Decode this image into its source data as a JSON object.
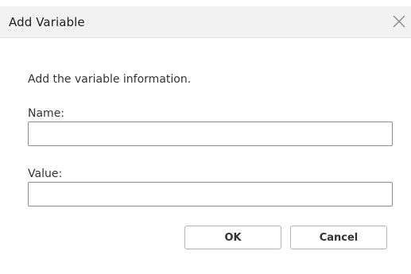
{
  "dialog": {
    "title": "Add Variable",
    "close_icon": "close-icon",
    "instruction": "Add the variable information.",
    "name_label": "Name:",
    "name_value": "",
    "value_label": "Value:",
    "value_value": "",
    "ok_label": "OK",
    "cancel_label": "Cancel"
  },
  "colors": {
    "titlebar_bg": "#f2f2f2",
    "input_border": "#8d8d8d",
    "button_border": "#b3b3b3",
    "text": "#333333"
  }
}
